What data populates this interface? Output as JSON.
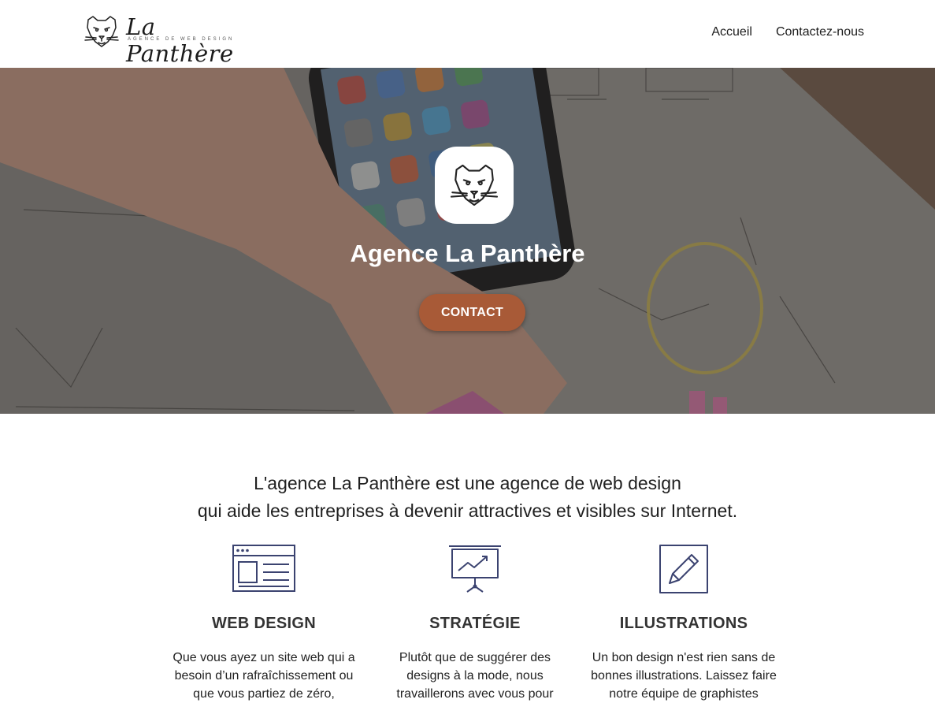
{
  "header": {
    "logo_name": "La Panthère",
    "logo_tagline": "AGENCE DE WEB DESIGN",
    "nav": [
      {
        "label": "Accueil"
      },
      {
        "label": "Contactez-nous"
      }
    ]
  },
  "hero": {
    "title": "Agence La Panthère",
    "button_label": "CONTACT",
    "button_color": "#a85a37"
  },
  "intro": {
    "line1": "L'agence La Panthère est une agence de web design",
    "line2": "qui aide les entreprises à devenir attractives et visibles sur Internet."
  },
  "services": [
    {
      "icon": "browser-window-icon",
      "title": "WEB DESIGN",
      "lines": [
        "Que vous ayez un site web qui a",
        "besoin d’un rafraîchissement ou",
        "que vous partiez de zéro,"
      ]
    },
    {
      "icon": "presentation-chart-icon",
      "title": "STRATÉGIE",
      "lines": [
        "Plutôt que de suggérer des",
        "designs à la mode, nous",
        "travaillerons avec vous pour"
      ]
    },
    {
      "icon": "pencil-edit-icon",
      "title": "ILLUSTRATIONS",
      "lines": [
        "Un bon design n'est rien sans de",
        "bonnes illustrations. Laissez faire",
        "notre équipe de graphistes"
      ]
    }
  ],
  "colors": {
    "icon_stroke": "#3b4370",
    "accent": "#a85a37"
  }
}
